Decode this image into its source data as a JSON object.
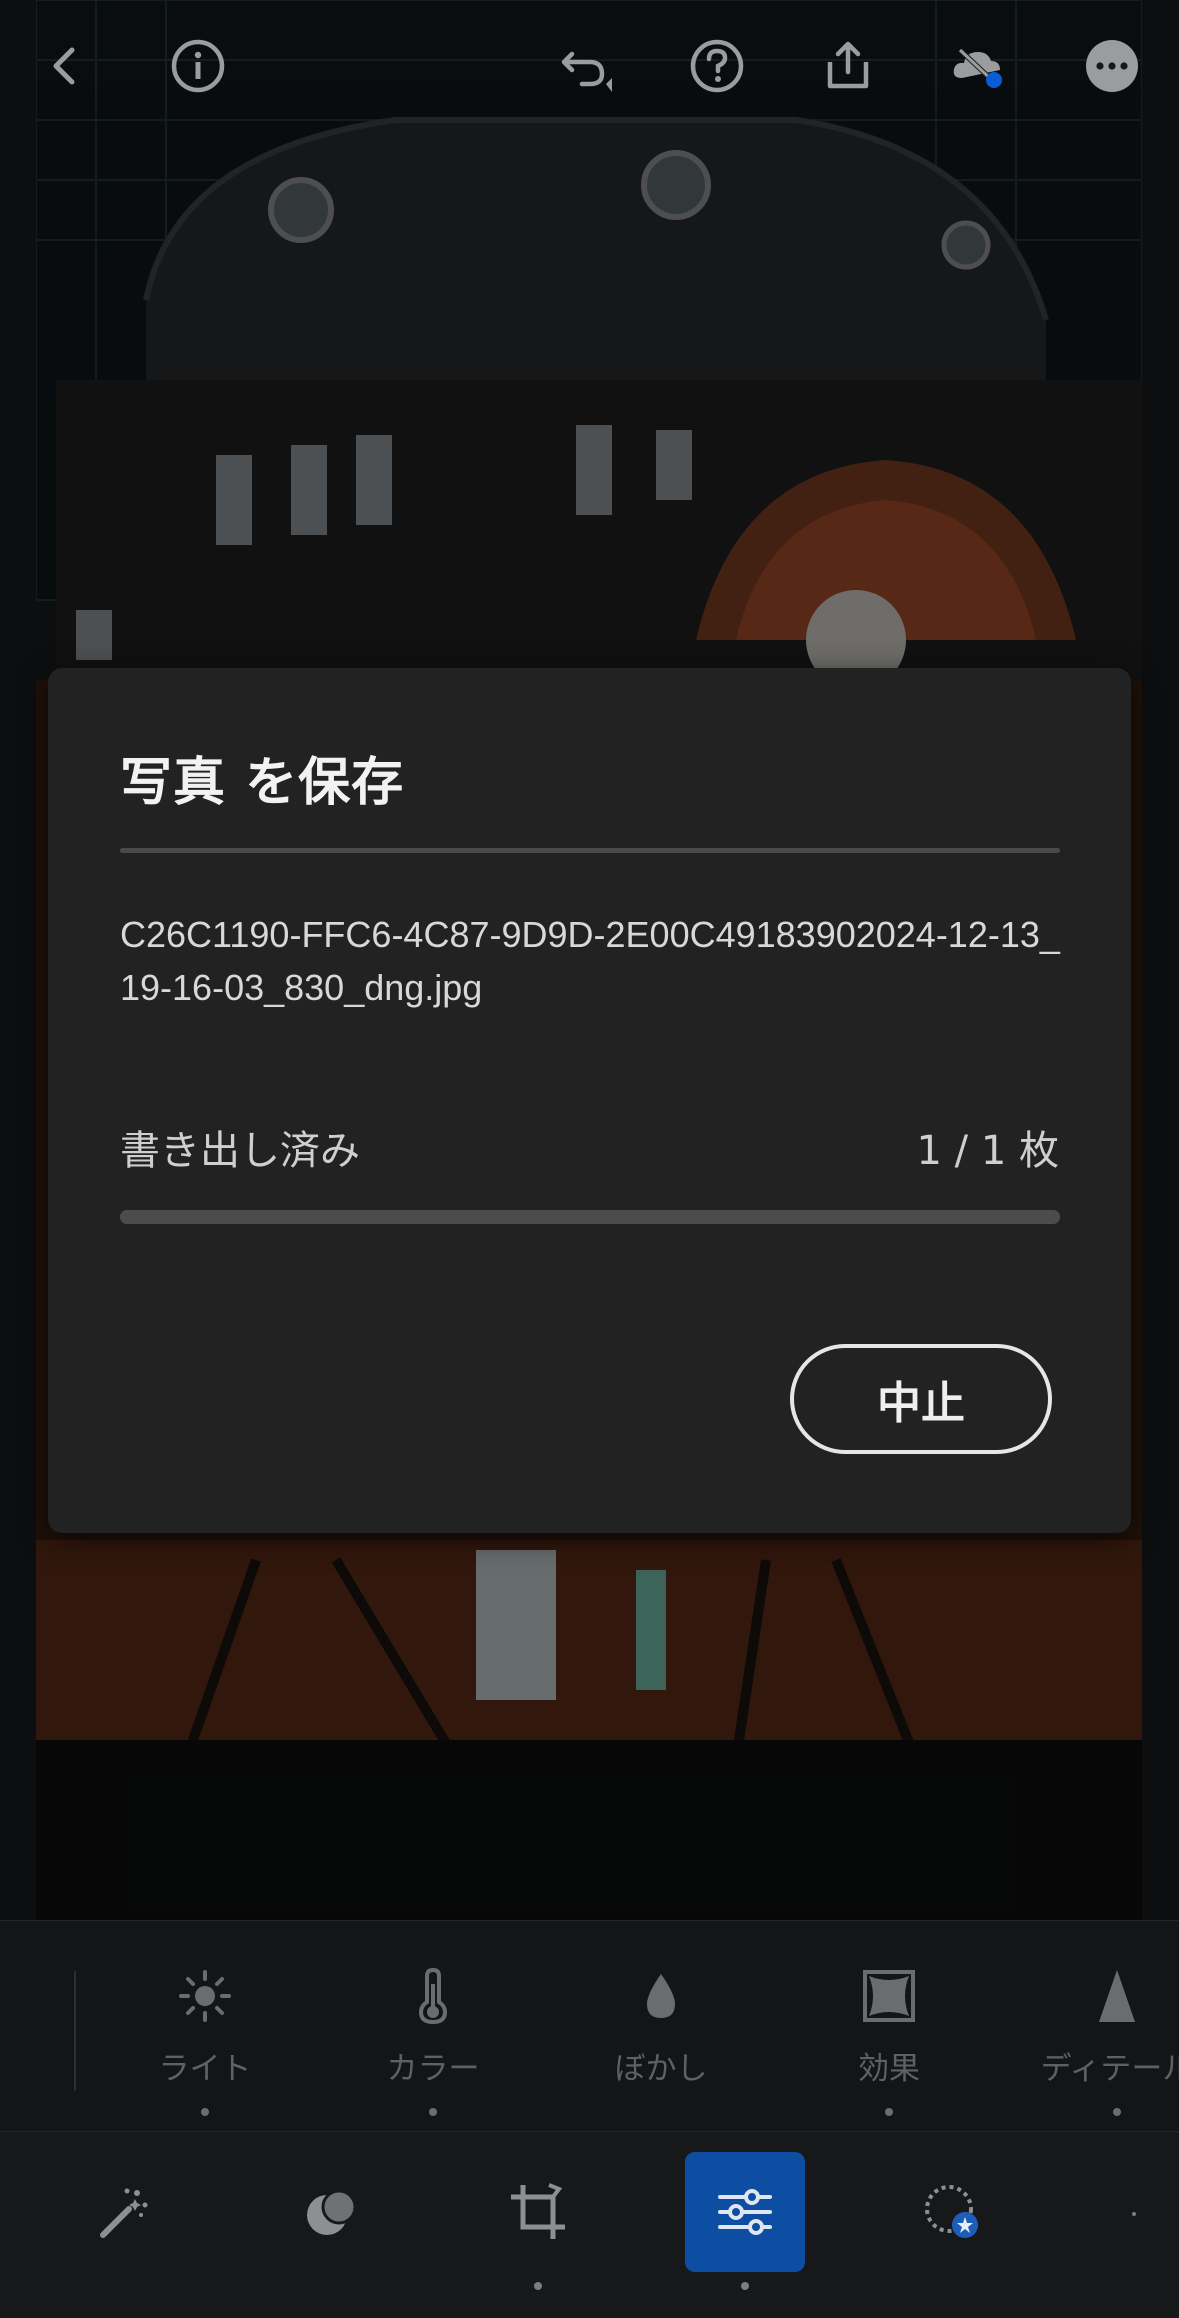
{
  "toolbar": {
    "icons": [
      "back-icon",
      "info-icon",
      "undo-icon",
      "help-icon",
      "share-icon",
      "cloud-sync-icon",
      "more-icon"
    ]
  },
  "dialog": {
    "title": "写真 を保存",
    "filename": "C26C1190-FFC6-4C87-9D9D-2E00C49183902024-12-13_19-16-03_830_dng.jpg",
    "status_label": "書き出し済み",
    "count": "1 / 1 枚",
    "progress": 1.0,
    "cancel_label": "中止"
  },
  "tools": [
    {
      "label": "ライト",
      "icon": "sun-icon"
    },
    {
      "label": "カラー",
      "icon": "thermometer-icon"
    },
    {
      "label": "ぼかし",
      "icon": "droplet-icon"
    },
    {
      "label": "効果",
      "icon": "vignette-frame-icon"
    },
    {
      "label": "ディテール",
      "icon": "triangle-icon"
    }
  ],
  "bottom_nav": {
    "items": [
      "auto-magic-wand-icon",
      "masking-icon",
      "crop-rotate-icon",
      "edit-sliders-icon",
      "presets-icon"
    ],
    "active": "edit-sliders-icon"
  },
  "colors": {
    "accent": "#0d4ea3",
    "dialog_bg": "#222223",
    "sync_dot": "#0a5bd6"
  }
}
